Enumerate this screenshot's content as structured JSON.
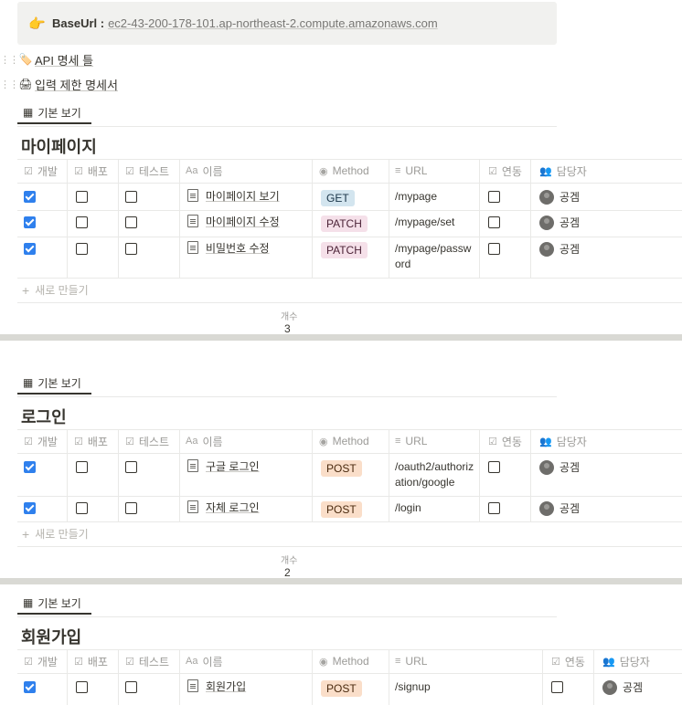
{
  "callout": {
    "emoji": "👉",
    "label": "BaseUrl :",
    "url": "ec2-43-200-178-101.ap-northeast-2.compute.amazonaws.com"
  },
  "pages": [
    {
      "icon": "🏷️",
      "title": "API 명세 틀"
    },
    {
      "icon": "🖨",
      "title": "입력 제한 명세서"
    }
  ],
  "columns": {
    "dev": "개발",
    "deploy": "배포",
    "test": "테스트",
    "name": "이름",
    "method": "Method",
    "url": "URL",
    "link": "연동",
    "owner": "담당자"
  },
  "view_tab": "기본 보기",
  "new_row": "새로 만들기",
  "count_label": "개수",
  "databases": [
    {
      "title": "마이페이지",
      "count": "3",
      "rows": [
        {
          "dev": true,
          "deploy": false,
          "test": false,
          "name": "마이페이지 보기",
          "method": "GET",
          "url": "/mypage",
          "link": false,
          "owner": "공겜"
        },
        {
          "dev": true,
          "deploy": false,
          "test": false,
          "name": "마이페이지 수정",
          "method": "PATCH",
          "url": "/mypage/set",
          "link": false,
          "owner": "공겜"
        },
        {
          "dev": true,
          "deploy": false,
          "test": false,
          "name": "비밀번호 수정",
          "method": "PATCH",
          "url": "/mypage/password",
          "link": false,
          "owner": "공겜"
        }
      ]
    },
    {
      "title": "로그인",
      "count": "2",
      "rows": [
        {
          "dev": true,
          "deploy": false,
          "test": false,
          "name": "구글 로그인",
          "method": "POST",
          "url": "/oauth2/authorization/google",
          "link": false,
          "owner": "공겜"
        },
        {
          "dev": true,
          "deploy": false,
          "test": false,
          "name": "자체 로그인",
          "method": "POST",
          "url": "/login",
          "link": false,
          "owner": "공겜"
        }
      ]
    },
    {
      "title": "회원가입",
      "rows": [
        {
          "dev": true,
          "deploy": false,
          "test": false,
          "name": "회원가입",
          "method": "POST",
          "url": "/signup",
          "link": false,
          "owner": "공겜"
        }
      ]
    }
  ],
  "colors": {
    "check_on": "#2f80ed",
    "get_tag": "#d3e5ef",
    "patch_tag": "#f5e0e9",
    "post_tag": "#fadec9"
  }
}
